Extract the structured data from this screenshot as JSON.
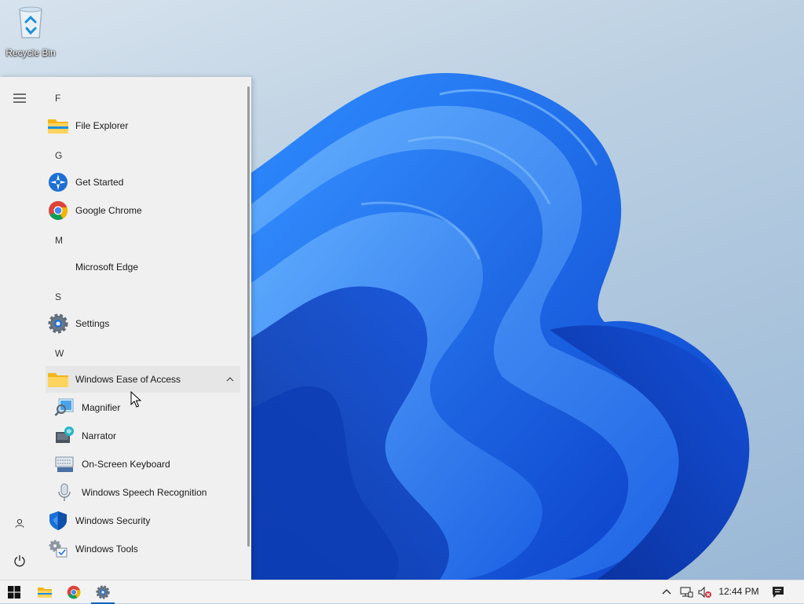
{
  "desktop": {
    "recycle_bin_label": "Recycle Bin",
    "wallpaper": "windows-11-bloom"
  },
  "start_menu": {
    "sections": [
      {
        "letter": "F",
        "apps": [
          {
            "label": "File Explorer",
            "icon": "folder-icon"
          }
        ]
      },
      {
        "letter": "G",
        "apps": [
          {
            "label": "Get Started",
            "icon": "get-started-icon"
          },
          {
            "label": "Google Chrome",
            "icon": "chrome-icon"
          }
        ]
      },
      {
        "letter": "M",
        "apps": [
          {
            "label": "Microsoft Edge",
            "icon": "none"
          }
        ]
      },
      {
        "letter": "S",
        "apps": [
          {
            "label": "Settings",
            "icon": "gear-icon"
          }
        ]
      },
      {
        "letter": "W",
        "apps": [
          {
            "label": "Windows Ease of Access",
            "icon": "folder-icon",
            "expanded": true,
            "children": [
              {
                "label": "Magnifier",
                "icon": "magnifier-icon"
              },
              {
                "label": "Narrator",
                "icon": "narrator-icon"
              },
              {
                "label": "On-Screen Keyboard",
                "icon": "keyboard-icon"
              },
              {
                "label": "Windows Speech Recognition",
                "icon": "microphone-icon"
              }
            ]
          },
          {
            "label": "Windows Security",
            "icon": "shield-icon"
          },
          {
            "label": "Windows Tools",
            "icon": "tools-icon"
          }
        ]
      }
    ],
    "rail": [
      "hamburger-icon",
      "user-icon",
      "power-icon"
    ]
  },
  "taskbar": {
    "pinned": [
      "windows-start-icon",
      "file-explorer-icon",
      "chrome-icon",
      "settings-icon"
    ],
    "active": "settings-icon",
    "clock": "12:44 PM",
    "tray": [
      "chevron-up-icon",
      "network-icon",
      "volume-muted-icon",
      "notification-icon"
    ]
  },
  "colors": {
    "accent": "#0067c0",
    "menu_bg": "#f0f0f0",
    "taskbar_bg": "#f3f3f3"
  }
}
